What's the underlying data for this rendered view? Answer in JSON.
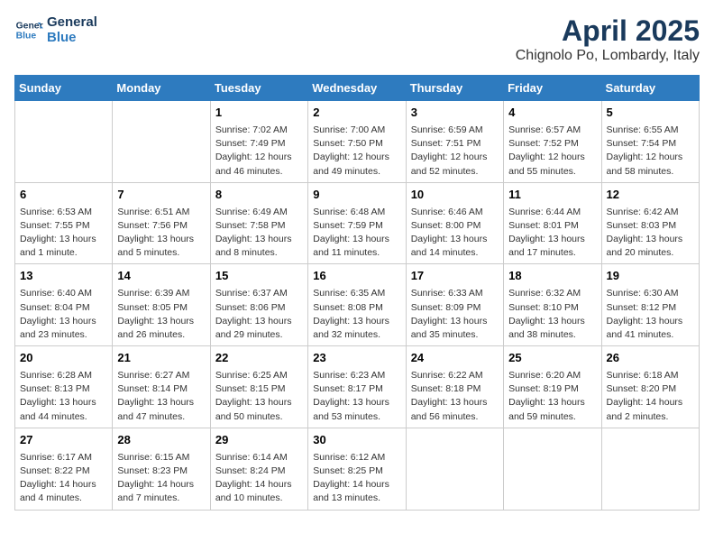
{
  "header": {
    "logo_line1": "General",
    "logo_line2": "Blue",
    "title": "April 2025",
    "subtitle": "Chignolo Po, Lombardy, Italy"
  },
  "days_of_week": [
    "Sunday",
    "Monday",
    "Tuesday",
    "Wednesday",
    "Thursday",
    "Friday",
    "Saturday"
  ],
  "weeks": [
    [
      {
        "day": "",
        "content": ""
      },
      {
        "day": "",
        "content": ""
      },
      {
        "day": "1",
        "content": "Sunrise: 7:02 AM\nSunset: 7:49 PM\nDaylight: 12 hours and 46 minutes."
      },
      {
        "day": "2",
        "content": "Sunrise: 7:00 AM\nSunset: 7:50 PM\nDaylight: 12 hours and 49 minutes."
      },
      {
        "day": "3",
        "content": "Sunrise: 6:59 AM\nSunset: 7:51 PM\nDaylight: 12 hours and 52 minutes."
      },
      {
        "day": "4",
        "content": "Sunrise: 6:57 AM\nSunset: 7:52 PM\nDaylight: 12 hours and 55 minutes."
      },
      {
        "day": "5",
        "content": "Sunrise: 6:55 AM\nSunset: 7:54 PM\nDaylight: 12 hours and 58 minutes."
      }
    ],
    [
      {
        "day": "6",
        "content": "Sunrise: 6:53 AM\nSunset: 7:55 PM\nDaylight: 13 hours and 1 minute."
      },
      {
        "day": "7",
        "content": "Sunrise: 6:51 AM\nSunset: 7:56 PM\nDaylight: 13 hours and 5 minutes."
      },
      {
        "day": "8",
        "content": "Sunrise: 6:49 AM\nSunset: 7:58 PM\nDaylight: 13 hours and 8 minutes."
      },
      {
        "day": "9",
        "content": "Sunrise: 6:48 AM\nSunset: 7:59 PM\nDaylight: 13 hours and 11 minutes."
      },
      {
        "day": "10",
        "content": "Sunrise: 6:46 AM\nSunset: 8:00 PM\nDaylight: 13 hours and 14 minutes."
      },
      {
        "day": "11",
        "content": "Sunrise: 6:44 AM\nSunset: 8:01 PM\nDaylight: 13 hours and 17 minutes."
      },
      {
        "day": "12",
        "content": "Sunrise: 6:42 AM\nSunset: 8:03 PM\nDaylight: 13 hours and 20 minutes."
      }
    ],
    [
      {
        "day": "13",
        "content": "Sunrise: 6:40 AM\nSunset: 8:04 PM\nDaylight: 13 hours and 23 minutes."
      },
      {
        "day": "14",
        "content": "Sunrise: 6:39 AM\nSunset: 8:05 PM\nDaylight: 13 hours and 26 minutes."
      },
      {
        "day": "15",
        "content": "Sunrise: 6:37 AM\nSunset: 8:06 PM\nDaylight: 13 hours and 29 minutes."
      },
      {
        "day": "16",
        "content": "Sunrise: 6:35 AM\nSunset: 8:08 PM\nDaylight: 13 hours and 32 minutes."
      },
      {
        "day": "17",
        "content": "Sunrise: 6:33 AM\nSunset: 8:09 PM\nDaylight: 13 hours and 35 minutes."
      },
      {
        "day": "18",
        "content": "Sunrise: 6:32 AM\nSunset: 8:10 PM\nDaylight: 13 hours and 38 minutes."
      },
      {
        "day": "19",
        "content": "Sunrise: 6:30 AM\nSunset: 8:12 PM\nDaylight: 13 hours and 41 minutes."
      }
    ],
    [
      {
        "day": "20",
        "content": "Sunrise: 6:28 AM\nSunset: 8:13 PM\nDaylight: 13 hours and 44 minutes."
      },
      {
        "day": "21",
        "content": "Sunrise: 6:27 AM\nSunset: 8:14 PM\nDaylight: 13 hours and 47 minutes."
      },
      {
        "day": "22",
        "content": "Sunrise: 6:25 AM\nSunset: 8:15 PM\nDaylight: 13 hours and 50 minutes."
      },
      {
        "day": "23",
        "content": "Sunrise: 6:23 AM\nSunset: 8:17 PM\nDaylight: 13 hours and 53 minutes."
      },
      {
        "day": "24",
        "content": "Sunrise: 6:22 AM\nSunset: 8:18 PM\nDaylight: 13 hours and 56 minutes."
      },
      {
        "day": "25",
        "content": "Sunrise: 6:20 AM\nSunset: 8:19 PM\nDaylight: 13 hours and 59 minutes."
      },
      {
        "day": "26",
        "content": "Sunrise: 6:18 AM\nSunset: 8:20 PM\nDaylight: 14 hours and 2 minutes."
      }
    ],
    [
      {
        "day": "27",
        "content": "Sunrise: 6:17 AM\nSunset: 8:22 PM\nDaylight: 14 hours and 4 minutes."
      },
      {
        "day": "28",
        "content": "Sunrise: 6:15 AM\nSunset: 8:23 PM\nDaylight: 14 hours and 7 minutes."
      },
      {
        "day": "29",
        "content": "Sunrise: 6:14 AM\nSunset: 8:24 PM\nDaylight: 14 hours and 10 minutes."
      },
      {
        "day": "30",
        "content": "Sunrise: 6:12 AM\nSunset: 8:25 PM\nDaylight: 14 hours and 13 minutes."
      },
      {
        "day": "",
        "content": ""
      },
      {
        "day": "",
        "content": ""
      },
      {
        "day": "",
        "content": ""
      }
    ]
  ]
}
